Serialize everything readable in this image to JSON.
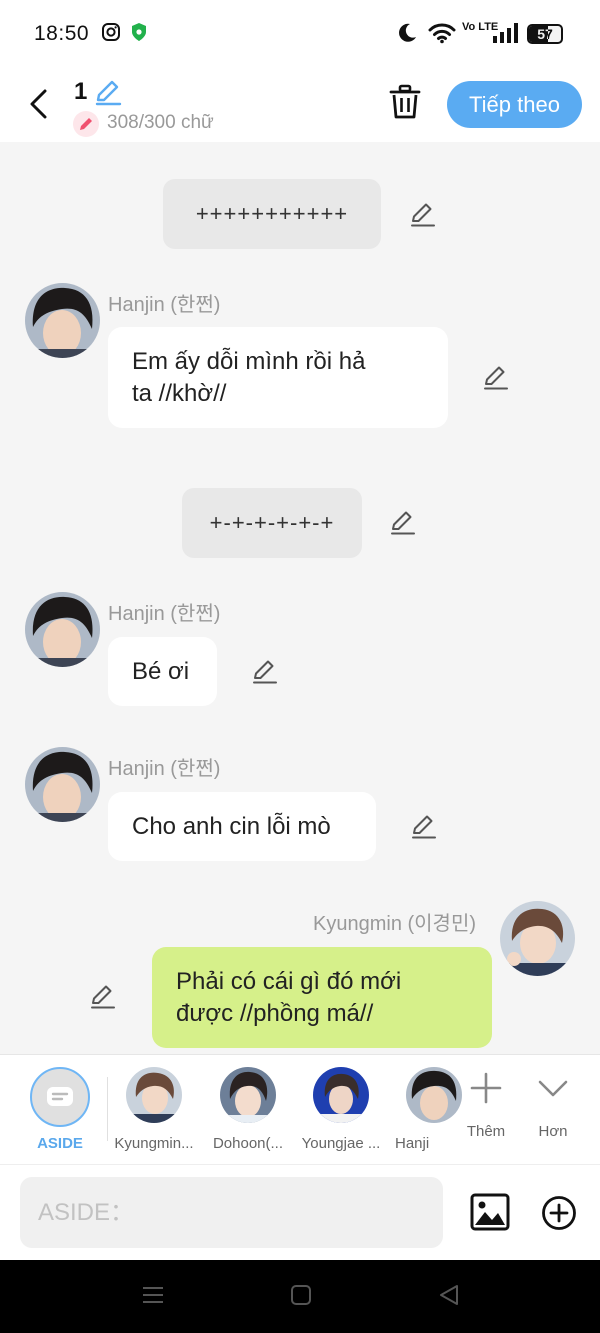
{
  "status_bar": {
    "time": "18:50",
    "battery": "57",
    "network": "Vo LTE",
    "icons": [
      "instagram-icon",
      "shield-icon",
      "moon-icon",
      "wifi-icon",
      "volte-icon",
      "signal-icon",
      "battery-icon"
    ]
  },
  "header": {
    "title": "1",
    "char_count": "308/300 chữ",
    "next_label": "Tiếp theo",
    "icons": [
      "back-icon",
      "edit-icon",
      "pencil-icon",
      "trash-icon"
    ]
  },
  "messages": [
    {
      "kind": "narration",
      "text": "+++++++++++"
    },
    {
      "kind": "character",
      "sender": "Hanjin (한쩐)",
      "text_lines": [
        "Em ấy dỗi mình rồi hả",
        "ta //khờ//"
      ]
    },
    {
      "kind": "narration",
      "text": "+-+-+-+-+-+"
    },
    {
      "kind": "character",
      "sender": "Hanjin (한쩐)",
      "text": "Bé ơi"
    },
    {
      "kind": "character",
      "sender": "Hanjin (한쩐)",
      "text": "Cho anh cin lỗi mò"
    },
    {
      "kind": "mine",
      "sender": "Kyungmin (이경민)",
      "text_lines": [
        "Phải có cái gì đó mới",
        "được //phồng má//"
      ]
    }
  ],
  "character_bar": {
    "aside_label": "ASIDE",
    "characters": [
      "Kyungmin...",
      "Dohoon(...",
      "Youngjae ...",
      "Hanji"
    ],
    "more_label": "Thêm",
    "collapse_label": "Hơn"
  },
  "input": {
    "placeholder": "ASIDE："
  },
  "colors": {
    "accent": "#5aabf2",
    "my_bubble": "#d6f08a",
    "narration_bg": "#e8e8e8",
    "chat_bg": "#f5f5f5"
  }
}
